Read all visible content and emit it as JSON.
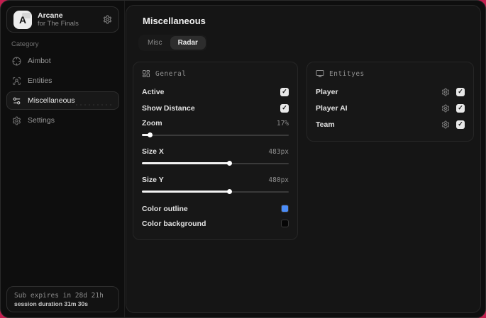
{
  "app": {
    "logo_letter": "A",
    "name": "Arcane",
    "subtitle": "for The Finals"
  },
  "sidebar": {
    "category_label": "Category",
    "items": [
      {
        "label": "Aimbot",
        "icon": "crosshair-icon",
        "active": false
      },
      {
        "label": "Entities",
        "icon": "user-icon",
        "active": false
      },
      {
        "label": "Miscellaneous",
        "icon": "sliders-icon",
        "active": true
      },
      {
        "label": "Settings",
        "icon": "gear-icon",
        "active": false
      }
    ],
    "footer": {
      "sub_expiry": "Sub expires in 28d 21h",
      "session_duration": "session duration 31m 30s"
    }
  },
  "main": {
    "title": "Miscellaneous",
    "tabs": [
      {
        "label": "Misc",
        "active": false
      },
      {
        "label": "Radar",
        "active": true
      }
    ],
    "general_panel": {
      "title": "General",
      "icon": "layout-icon",
      "active": {
        "label": "Active",
        "checked": true
      },
      "show_distance": {
        "label": "Show Distance",
        "checked": true
      },
      "zoom": {
        "label": "Zoom",
        "value": "17%",
        "percent": 6
      },
      "size_x": {
        "label": "Size X",
        "value": "483px",
        "percent": 60
      },
      "size_y": {
        "label": "Size Y",
        "value": "480px",
        "percent": 60
      },
      "color_outline": {
        "label": "Color outline",
        "color": "#4b8df8"
      },
      "color_background": {
        "label": "Color background",
        "color": "#060606"
      }
    },
    "entities_panel": {
      "title": "Entityes",
      "icon": "monitor-icon",
      "rows": [
        {
          "label": "Player",
          "checked": true
        },
        {
          "label": "Player AI",
          "checked": true
        },
        {
          "label": "Team",
          "checked": true
        }
      ]
    }
  },
  "colors": {
    "background_accent": "#c41e4f",
    "outline_blue": "#4b8df8"
  }
}
